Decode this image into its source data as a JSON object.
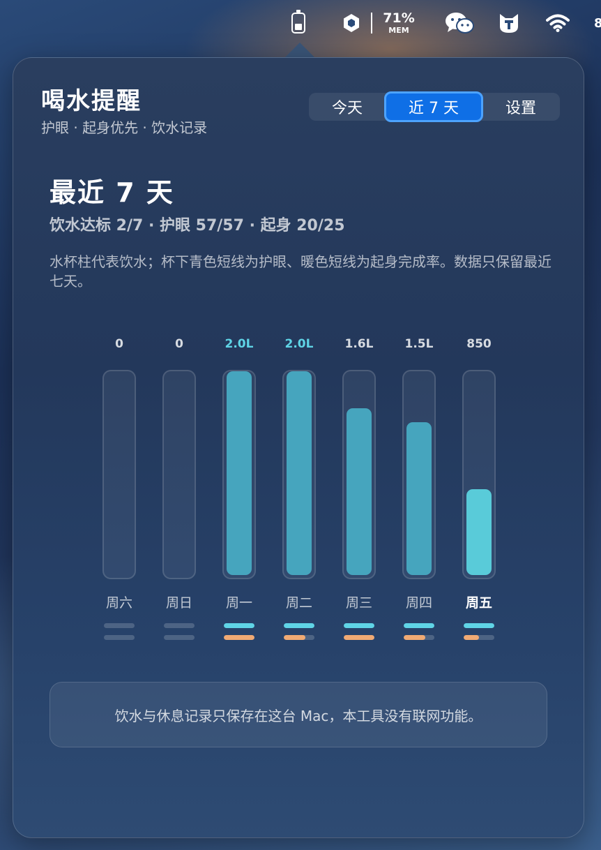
{
  "menubar": {
    "mem_percent": "71%",
    "mem_label": "MEM",
    "clipped_text": "8"
  },
  "panel": {
    "title": "喝水提醒",
    "subtitle": "护眼 · 起身优先 · 饮水记录",
    "tabs": [
      {
        "label": "今天",
        "active": false
      },
      {
        "label": "近 7 天",
        "active": true
      },
      {
        "label": "设置",
        "active": false
      }
    ],
    "heading": "最近 7 天",
    "stats": "饮水达标 2/7 · 护眼 57/57 · 起身 20/25",
    "description": "水杯柱代表饮水；杯下青色短线为护眼、暖色短线为起身完成率。数据只保留最近七天。",
    "footer": "饮水与休息记录只保存在这台 Mac，本工具没有联网功能。"
  },
  "colors": {
    "accent": "#0f6fe6",
    "water": "#46a5be",
    "water_today": "#59cbd9",
    "eye": "#5fd4e6",
    "standup": "#f0aa74"
  },
  "chart_data": {
    "type": "bar",
    "categories": [
      "周六",
      "周日",
      "周一",
      "周二",
      "周三",
      "周四",
      "周五"
    ],
    "values_label": [
      "0",
      "0",
      "2.0L",
      "2.0L",
      "1.6L",
      "1.5L",
      "850"
    ],
    "water_fill": [
      0,
      0,
      1.0,
      1.0,
      0.82,
      0.75,
      0.42
    ],
    "eye_completion": [
      0,
      0,
      1.0,
      1.0,
      1.0,
      1.0,
      1.0
    ],
    "standup_completion": [
      0,
      0,
      1.0,
      0.7,
      1.0,
      0.7,
      0.5
    ],
    "today_index": 6,
    "highlight_values": [
      2,
      3
    ]
  }
}
